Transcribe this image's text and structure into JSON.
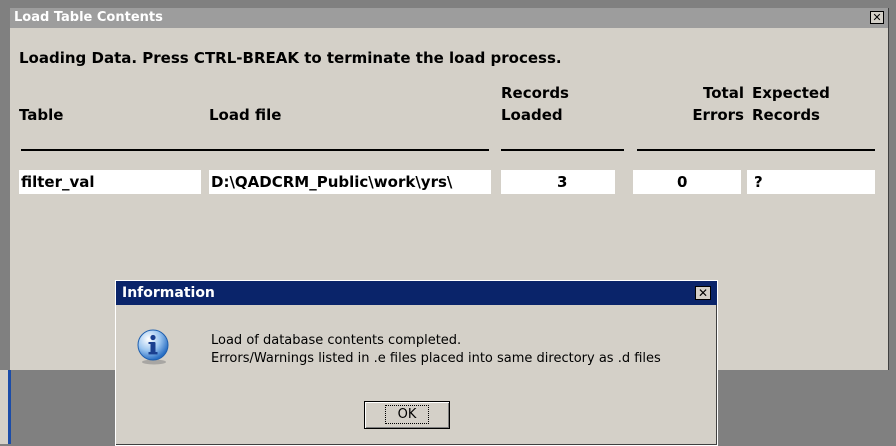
{
  "main_window": {
    "title": "Load Table Contents",
    "close_glyph": "✕",
    "status_text": "Loading Data.  Press CTRL-BREAK to terminate the load process.",
    "columns": {
      "table": "Table",
      "load_file": "Load file",
      "records_loaded": [
        "Records",
        "Loaded"
      ],
      "total_errors": [
        "Total",
        "Errors"
      ],
      "expected_records": [
        "Expected",
        "Records"
      ]
    },
    "row": {
      "table": "filter_val",
      "load_file": "D:\\QADCRM_Public\\work\\yrs\\",
      "records_loaded": "3",
      "total_errors": "0",
      "expected_records": "?"
    }
  },
  "dialog": {
    "title": "Information",
    "close_glyph": "✕",
    "icon": "information-icon",
    "message_line1": "Load of database contents completed.",
    "message_line2": "Errors/Warnings listed in .e files placed into same directory as .d files",
    "ok_label": "OK"
  },
  "colors": {
    "window_bg": "#d4d0c8",
    "inactive_title": "#9d9d9d",
    "active_title": "#0a246a",
    "desktop": "#808080"
  }
}
